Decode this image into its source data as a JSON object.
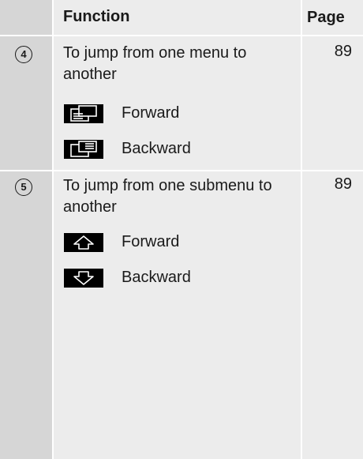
{
  "header": {
    "function": "Function",
    "page": "Page"
  },
  "rows": [
    {
      "marker": "4",
      "description": "To jump from one menu to another",
      "page": "89",
      "items": [
        {
          "icon": "menu-forward-icon",
          "label": "Forward"
        },
        {
          "icon": "menu-backward-icon",
          "label": "Backward"
        }
      ]
    },
    {
      "marker": "5",
      "description": "To jump from one submenu to another",
      "page": "89",
      "items": [
        {
          "icon": "arrow-up-icon",
          "label": "Forward"
        },
        {
          "icon": "arrow-down-icon",
          "label": "Backward"
        }
      ]
    }
  ]
}
